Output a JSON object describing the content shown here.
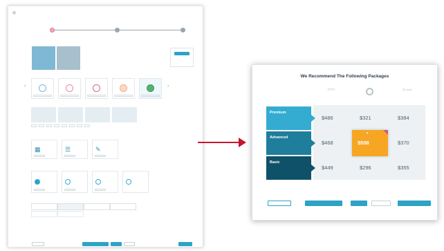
{
  "left_panel": {
    "steps": [
      "",
      "",
      ""
    ],
    "hero": {
      "tile_a": "",
      "tile_b": ""
    },
    "summary": {
      "price": ""
    },
    "icon_cards": [
      "",
      "",
      "",
      "",
      ""
    ],
    "grid_cells": [
      "",
      "",
      "",
      ""
    ],
    "options": [
      "",
      "",
      ""
    ],
    "radios": [
      "",
      "",
      "",
      ""
    ],
    "tabs": [
      "",
      "",
      "",
      ""
    ]
  },
  "modal": {
    "title": "We Recommend The Following Packages",
    "providers": [
      "",
      "",
      ""
    ],
    "packages": [
      {
        "name": "Premium",
        "sub": ""
      },
      {
        "name": "Advanced",
        "sub": ""
      },
      {
        "name": "Basic",
        "sub": ""
      }
    ],
    "prices": [
      [
        "$486",
        "$321",
        "$384"
      ],
      [
        "$468",
        "$558",
        "$370"
      ],
      [
        "$449",
        "$296",
        "$355"
      ]
    ],
    "highlight": {
      "row": 1,
      "col": 1,
      "color": "#f6a623"
    },
    "footer": [
      "",
      "",
      "",
      "",
      ""
    ]
  },
  "colors": {
    "accent": "#2ea3c4",
    "premium": "#34acd2",
    "advanced": "#1e7e9c",
    "basic": "#0f5168",
    "arrow": "#c4162e"
  }
}
